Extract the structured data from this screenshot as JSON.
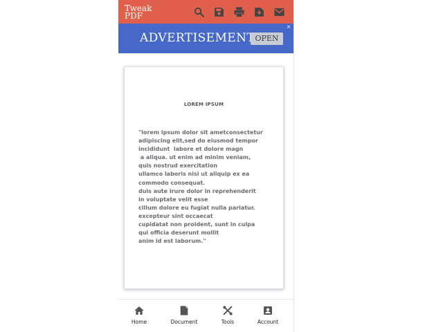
{
  "app": {
    "title": "Tweak PDF"
  },
  "colors": {
    "header": "#e0604c",
    "ad_banner": "#4568c9",
    "icon": "#555555"
  },
  "toolbar": {
    "icons": [
      "search-icon",
      "save-icon",
      "print-icon",
      "download-icon",
      "mail-icon"
    ]
  },
  "ad": {
    "label": "ADVERTISEMENT",
    "open_label": "OPEN",
    "close_label": "×"
  },
  "document": {
    "title": "LOREM IPSUM",
    "body": "\"lorem ipsum dolor sit ametconsectetur\nadipiscing elit,sed do eiusmod tempor\nincididunt  labore et dolore magn\n a aliqua. ut enim ad minim veniam,\nquis nostrud exercitation\nullamco laboris nisi ut aliquip ex ea\ncommodo consequat.\nduis aute irure dolor in reprehenderit\nin voluptate velit esse\ncillum dolore eu fugiat nulla pariatur.\nexcepteur sint occaecat\ncupidatat non proident, sunt in culpa\nqui officia deserunt mollit\nanim id est laborum.\""
  },
  "nav": [
    {
      "label": "Home",
      "icon": "home-icon"
    },
    {
      "label": "Document",
      "icon": "document-icon"
    },
    {
      "label": "Tools",
      "icon": "tools-icon"
    },
    {
      "label": "Account",
      "icon": "account-icon"
    }
  ]
}
